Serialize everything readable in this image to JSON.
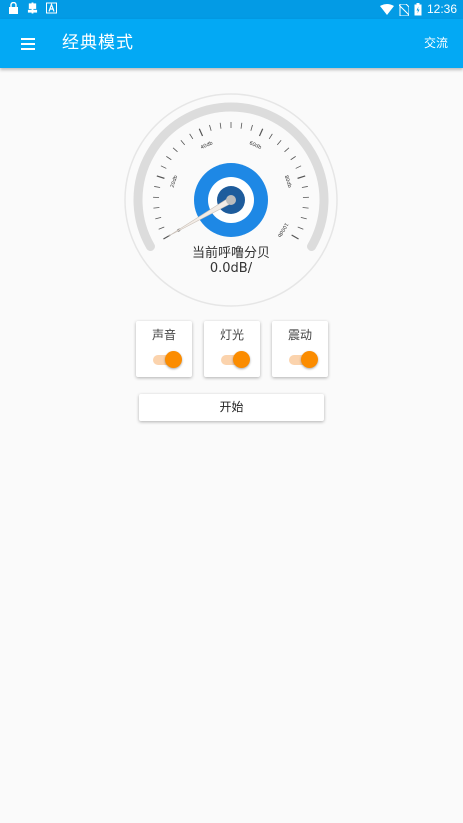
{
  "status_bar": {
    "time": "12:36",
    "left_icons": [
      "lock-notification-icon",
      "bug-notification-icon",
      "font-notification-icon"
    ],
    "right_icons": [
      "wifi-icon",
      "no-sim-icon",
      "battery-icon"
    ]
  },
  "app_bar": {
    "title": "经典模式",
    "menu_icon": "hamburger-menu-icon",
    "action_label": "交流",
    "background": "#03a9f4",
    "status_background": "#039be5"
  },
  "gauge": {
    "tick_labels": [
      "0",
      "20db",
      "40db",
      "60db",
      "80db",
      "100db"
    ],
    "caption": "当前呼噜分贝",
    "value_text": "0.0dB/",
    "needle_value": 0,
    "accent": "#1e88e5"
  },
  "toggles": [
    {
      "label": "声音",
      "on": true
    },
    {
      "label": "灯光",
      "on": true
    },
    {
      "label": "震动",
      "on": true
    }
  ],
  "toggle_color": "#fb8c00",
  "start_button": {
    "label": "开始"
  }
}
